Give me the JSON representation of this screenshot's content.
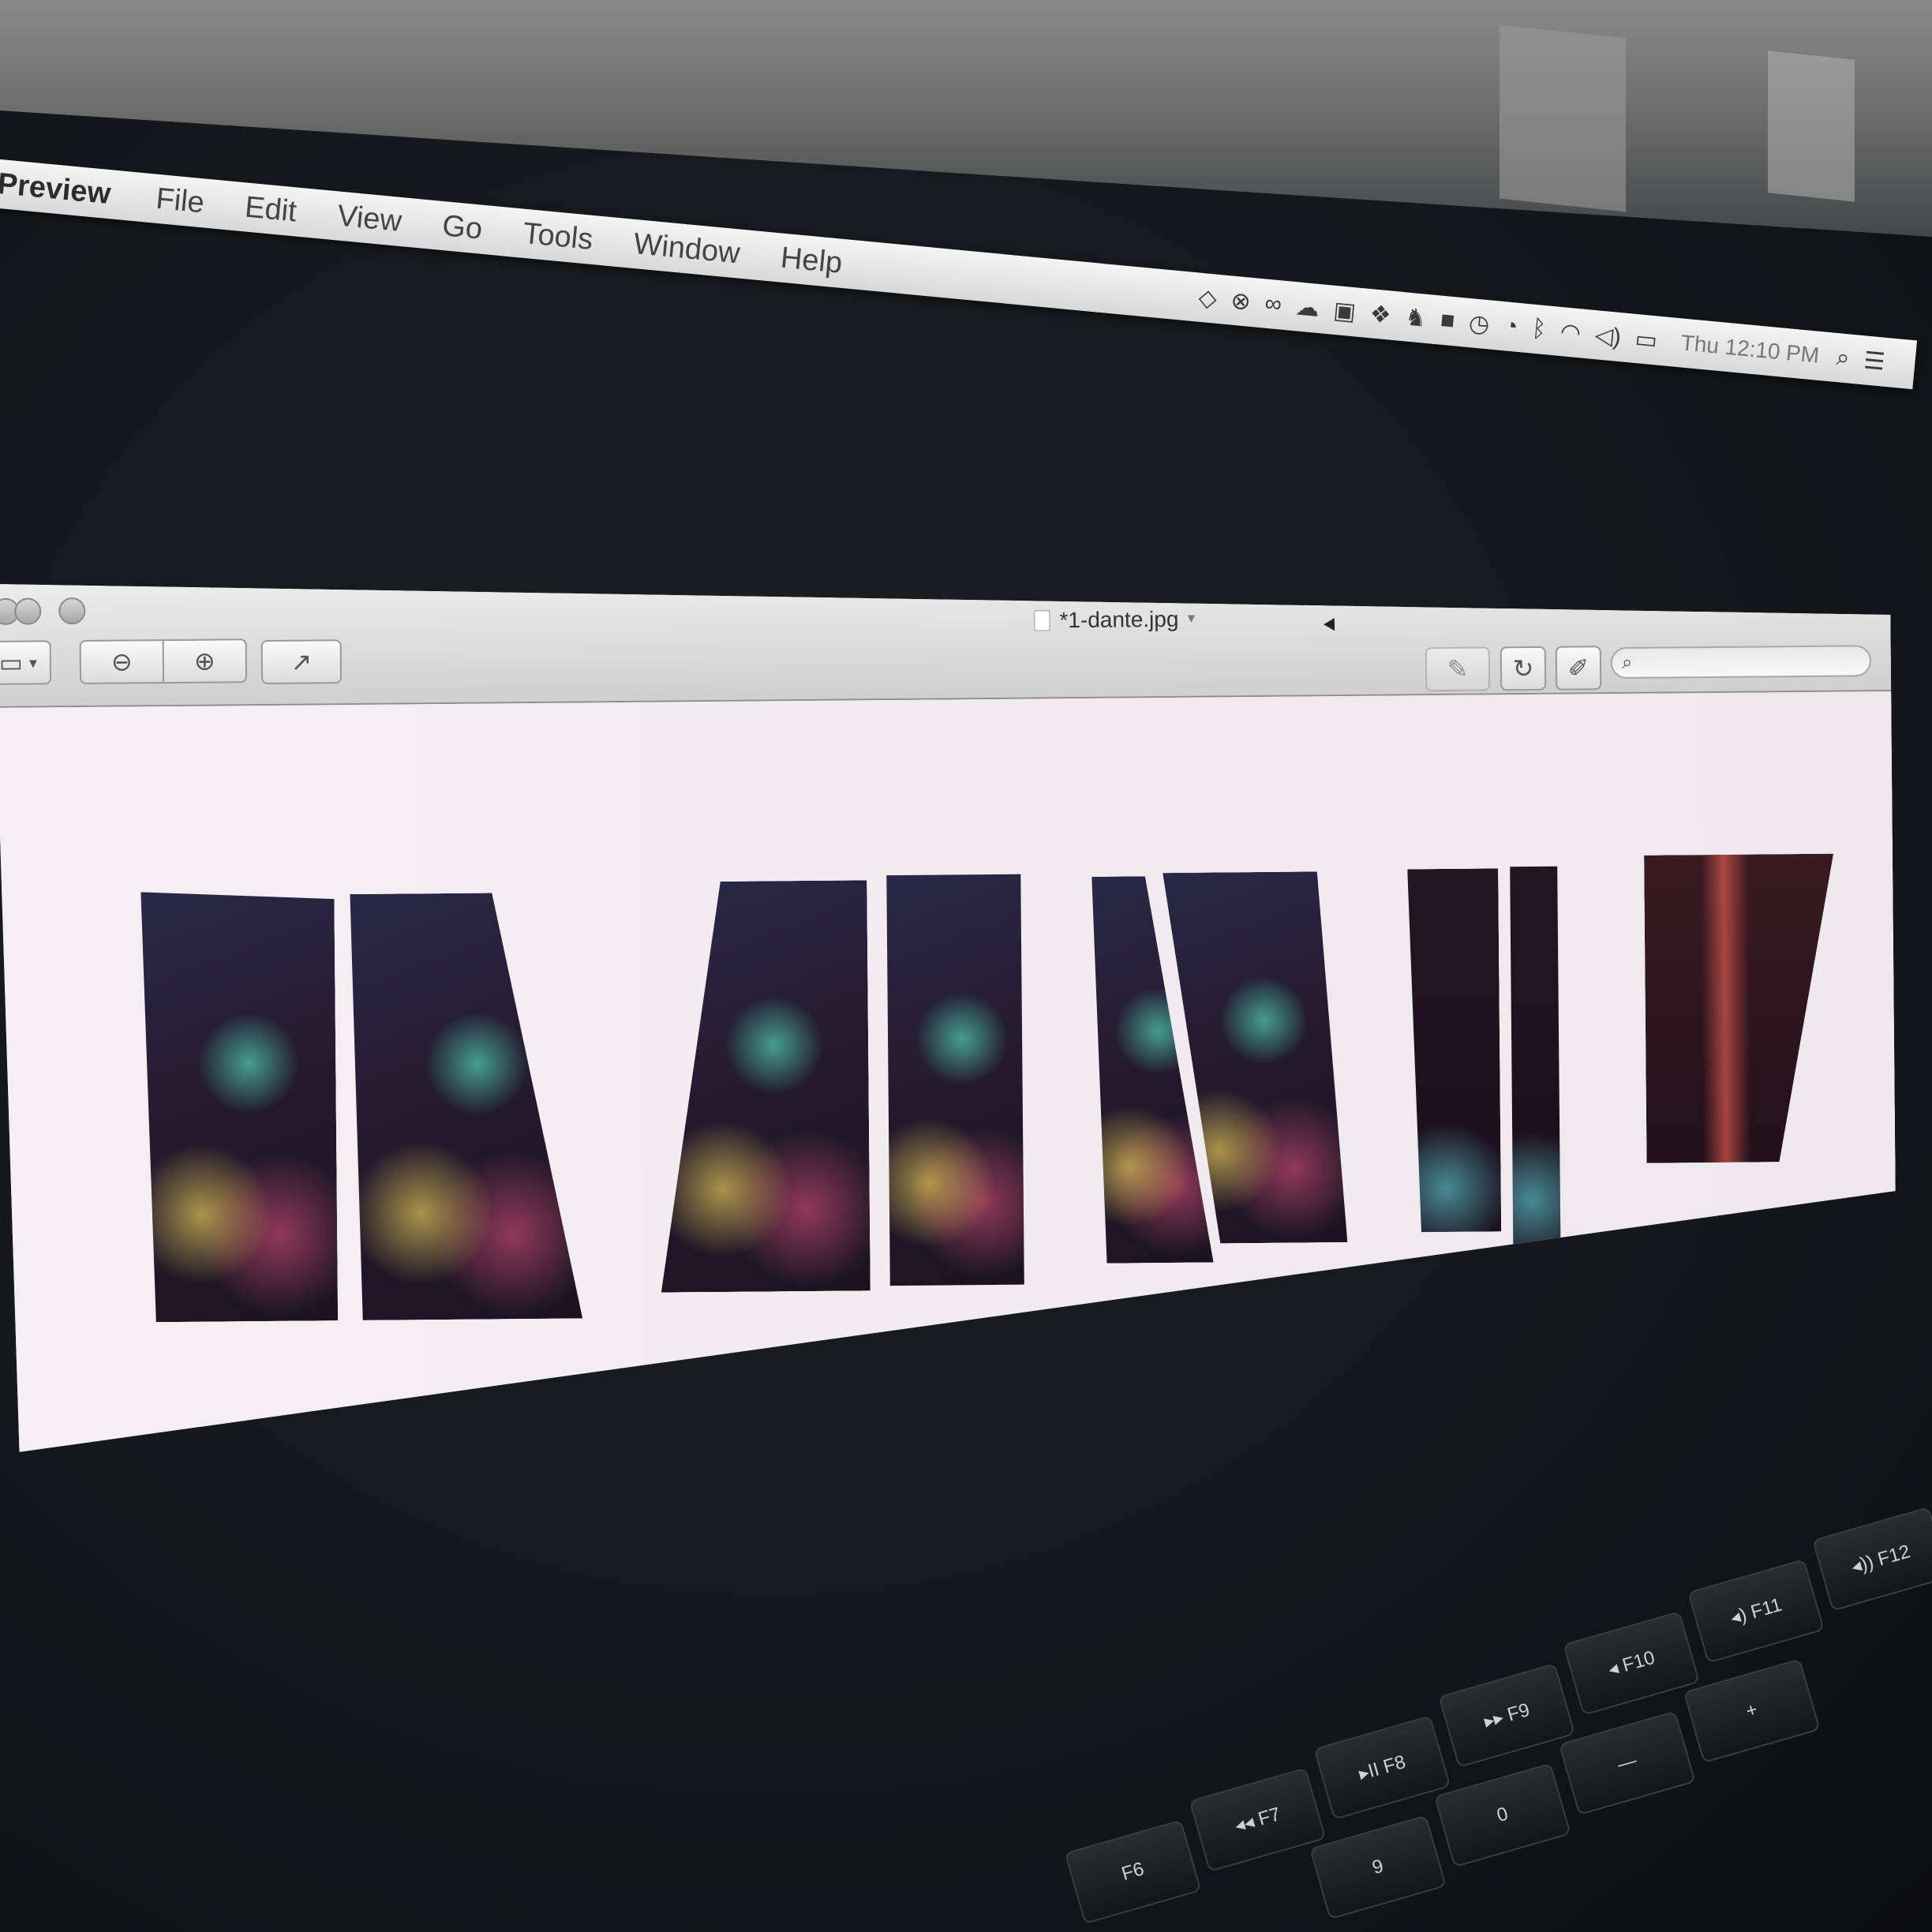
{
  "menubar": {
    "app_name": "Preview",
    "items": [
      "File",
      "Edit",
      "View",
      "Go",
      "Tools",
      "Window",
      "Help"
    ],
    "status_icons": [
      "dropbox-icon",
      "adobe-icon",
      "creative-cloud-icon",
      "cloud-icon",
      "app-icon",
      "dropbox-sync-icon",
      "evernote-icon",
      "square-icon",
      "clock-icon",
      "time-machine-icon",
      "bluetooth-icon",
      "wifi-icon",
      "volume-icon",
      "battery-icon"
    ],
    "clock": "Thu 12:10 PM"
  },
  "window": {
    "title": "*1-dante.jpg",
    "toolbar": {
      "sidebar_icon": "▭",
      "sidebar_caret": "▾",
      "zoom_out_icon": "⊖",
      "zoom_in_icon": "⊕",
      "share_icon": "↗",
      "markup_icon": "✎",
      "rotate_icon": "↻",
      "annotate_icon": "✐",
      "search_icon": "⌕",
      "search_value": ""
    }
  },
  "keyboard": {
    "keys": [
      "F6",
      "◂◂ F7",
      "▸II F8",
      "▸▸ F9",
      "◂ F10",
      "◂) F11",
      "◂)) F12",
      "9",
      "0",
      "—",
      "+"
    ]
  },
  "colors": {
    "menubar_bg": "#e6e6e6",
    "canvas_bg": "#f2eff1",
    "desktop_bg": "#15171a"
  }
}
